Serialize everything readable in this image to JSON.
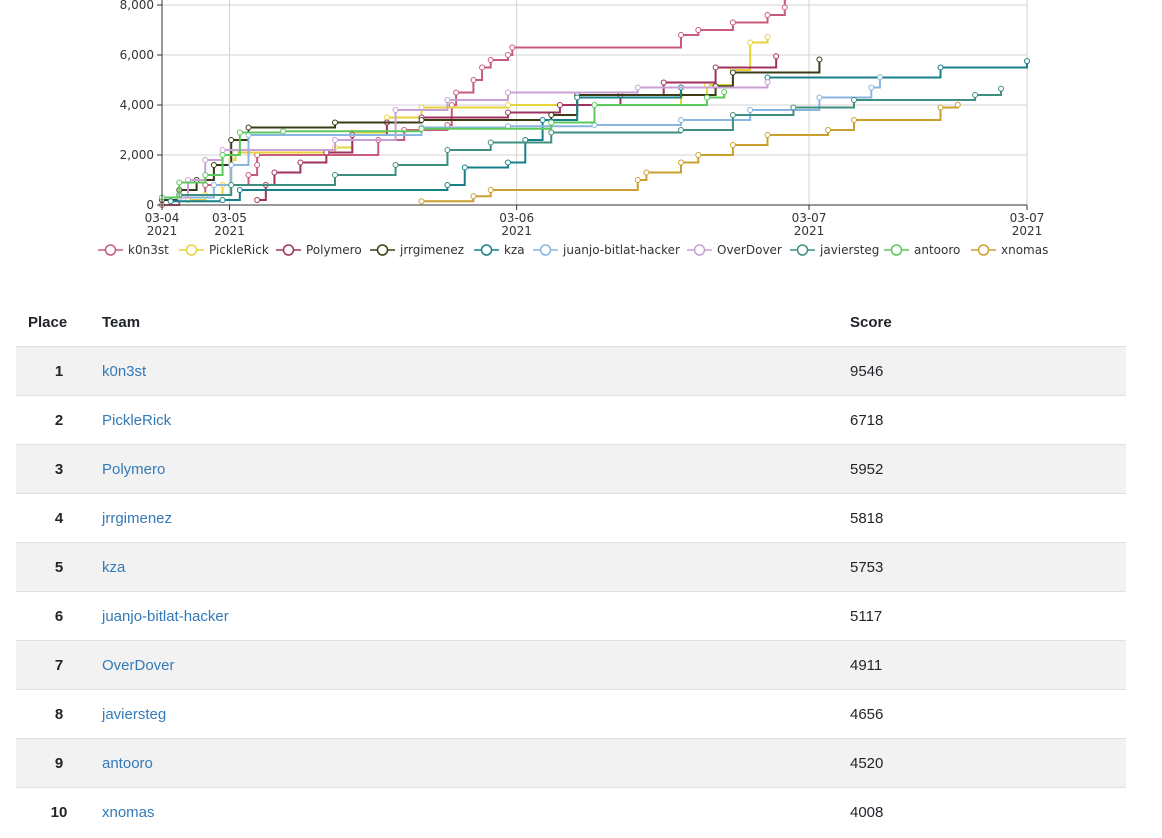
{
  "chart_data": {
    "type": "line",
    "yticks": [
      "0",
      "2,000",
      "4,000",
      "6,000",
      "8,000"
    ],
    "xticks": [
      {
        "t": "03-04",
        "line2": "2021",
        "x": 0
      },
      {
        "t": "03-05",
        "line2": "2021",
        "x": 0.078
      },
      {
        "t": "03-06",
        "line2": "2021",
        "x": 0.41
      },
      {
        "t": "03-07",
        "line2": "2021",
        "x": 0.748
      },
      {
        "t": "03-07",
        "line2": "2021",
        "x": 1.0
      }
    ],
    "ylim": [
      0,
      8400
    ],
    "xlim": [
      0,
      1
    ],
    "grid": true,
    "legend": "bottom",
    "series": [
      {
        "name": "k0n3st",
        "color": "#c75b7a",
        "points": [
          [
            0,
            0
          ],
          [
            0.02,
            400
          ],
          [
            0.05,
            800
          ],
          [
            0.1,
            1200
          ],
          [
            0.11,
            1600
          ],
          [
            0.11,
            2000
          ],
          [
            0.25,
            2600
          ],
          [
            0.28,
            3000
          ],
          [
            0.33,
            3200
          ],
          [
            0.335,
            4000
          ],
          [
            0.34,
            4500
          ],
          [
            0.36,
            5000
          ],
          [
            0.37,
            5500
          ],
          [
            0.38,
            5800
          ],
          [
            0.4,
            6000
          ],
          [
            0.405,
            6300
          ],
          [
            0.6,
            6800
          ],
          [
            0.62,
            7000
          ],
          [
            0.66,
            7300
          ],
          [
            0.7,
            7600
          ],
          [
            0.72,
            7900
          ],
          [
            0.72,
            8300
          ],
          [
            0.73,
            9546
          ]
        ]
      },
      {
        "name": "PickleRick",
        "color": "#e6d339",
        "points": [
          [
            0.03,
            200
          ],
          [
            0.05,
            400
          ],
          [
            0.07,
            800
          ],
          [
            0.08,
            1800
          ],
          [
            0.085,
            2100
          ],
          [
            0.2,
            2300
          ],
          [
            0.22,
            2900
          ],
          [
            0.26,
            3500
          ],
          [
            0.3,
            3900
          ],
          [
            0.4,
            4000
          ],
          [
            0.6,
            4400
          ],
          [
            0.63,
            4800
          ],
          [
            0.66,
            5400
          ],
          [
            0.68,
            6500
          ],
          [
            0.7,
            6718
          ]
        ]
      },
      {
        "name": "Polymero",
        "color": "#a0325f",
        "points": [
          [
            0.11,
            200
          ],
          [
            0.12,
            800
          ],
          [
            0.13,
            1300
          ],
          [
            0.16,
            1700
          ],
          [
            0.19,
            2100
          ],
          [
            0.22,
            2800
          ],
          [
            0.26,
            3300
          ],
          [
            0.3,
            3500
          ],
          [
            0.4,
            3700
          ],
          [
            0.46,
            4000
          ],
          [
            0.53,
            4400
          ],
          [
            0.58,
            4900
          ],
          [
            0.64,
            5500
          ],
          [
            0.71,
            5952
          ]
        ]
      },
      {
        "name": "jrrgimenez",
        "color": "#3b3b16",
        "points": [
          [
            0,
            200
          ],
          [
            0.02,
            600
          ],
          [
            0.04,
            1000
          ],
          [
            0.06,
            1600
          ],
          [
            0.08,
            2600
          ],
          [
            0.1,
            3100
          ],
          [
            0.2,
            3300
          ],
          [
            0.3,
            3400
          ],
          [
            0.45,
            3600
          ],
          [
            0.48,
            4400
          ],
          [
            0.64,
            4750
          ],
          [
            0.66,
            5300
          ],
          [
            0.76,
            5818
          ]
        ]
      },
      {
        "name": "kza",
        "color": "#17808a",
        "points": [
          [
            0.01,
            150
          ],
          [
            0.07,
            200
          ],
          [
            0.09,
            600
          ],
          [
            0.33,
            800
          ],
          [
            0.35,
            1500
          ],
          [
            0.4,
            1700
          ],
          [
            0.42,
            2600
          ],
          [
            0.44,
            3400
          ],
          [
            0.48,
            4300
          ],
          [
            0.6,
            4700
          ],
          [
            0.7,
            5100
          ],
          [
            0.9,
            5500
          ],
          [
            1.0,
            5753
          ]
        ]
      },
      {
        "name": "juanjo-bitlat-hacker",
        "color": "#88b6e0",
        "points": [
          [
            0.02,
            300
          ],
          [
            0.06,
            800
          ],
          [
            0.08,
            1600
          ],
          [
            0.1,
            2800
          ],
          [
            0.3,
            3100
          ],
          [
            0.4,
            3150
          ],
          [
            0.5,
            3200
          ],
          [
            0.6,
            3400
          ],
          [
            0.68,
            3800
          ],
          [
            0.76,
            4300
          ],
          [
            0.82,
            4700
          ],
          [
            0.83,
            5117
          ]
        ]
      },
      {
        "name": "OverDover",
        "color": "#c9a0d6",
        "points": [
          [
            0,
            300
          ],
          [
            0.03,
            1000
          ],
          [
            0.05,
            1800
          ],
          [
            0.07,
            2200
          ],
          [
            0.2,
            2600
          ],
          [
            0.27,
            3800
          ],
          [
            0.33,
            4200
          ],
          [
            0.4,
            4500
          ],
          [
            0.55,
            4700
          ],
          [
            0.7,
            4911
          ]
        ]
      },
      {
        "name": "javiersteg",
        "color": "#3f8f80",
        "points": [
          [
            0.02,
            400
          ],
          [
            0.08,
            800
          ],
          [
            0.2,
            1200
          ],
          [
            0.27,
            1600
          ],
          [
            0.33,
            2200
          ],
          [
            0.38,
            2500
          ],
          [
            0.45,
            2900
          ],
          [
            0.6,
            3000
          ],
          [
            0.66,
            3600
          ],
          [
            0.73,
            3900
          ],
          [
            0.8,
            4200
          ],
          [
            0.94,
            4400
          ],
          [
            0.97,
            4656
          ]
        ]
      },
      {
        "name": "antooro",
        "color": "#5cc95c",
        "points": [
          [
            0,
            300
          ],
          [
            0.02,
            900
          ],
          [
            0.05,
            1200
          ],
          [
            0.07,
            2000
          ],
          [
            0.09,
            2900
          ],
          [
            0.14,
            2950
          ],
          [
            0.3,
            3050
          ],
          [
            0.45,
            3300
          ],
          [
            0.5,
            4000
          ],
          [
            0.63,
            4300
          ],
          [
            0.65,
            4520
          ]
        ]
      },
      {
        "name": "xnomas",
        "color": "#c9a030",
        "points": [
          [
            0.3,
            150
          ],
          [
            0.36,
            350
          ],
          [
            0.38,
            600
          ],
          [
            0.55,
            1000
          ],
          [
            0.56,
            1300
          ],
          [
            0.6,
            1700
          ],
          [
            0.62,
            2000
          ],
          [
            0.66,
            2400
          ],
          [
            0.7,
            2800
          ],
          [
            0.77,
            3000
          ],
          [
            0.8,
            3400
          ],
          [
            0.9,
            3900
          ],
          [
            0.92,
            4008
          ]
        ]
      }
    ]
  },
  "table": {
    "headers": {
      "place": "Place",
      "team": "Team",
      "score": "Score"
    },
    "rows": [
      {
        "place": "1",
        "team": "k0n3st",
        "score": "9546"
      },
      {
        "place": "2",
        "team": "PickleRick",
        "score": "6718"
      },
      {
        "place": "3",
        "team": "Polymero",
        "score": "5952"
      },
      {
        "place": "4",
        "team": "jrrgimenez",
        "score": "5818"
      },
      {
        "place": "5",
        "team": "kza",
        "score": "5753"
      },
      {
        "place": "6",
        "team": "juanjo-bitlat-hacker",
        "score": "5117"
      },
      {
        "place": "7",
        "team": "OverDover",
        "score": "4911"
      },
      {
        "place": "8",
        "team": "javiersteg",
        "score": "4656"
      },
      {
        "place": "9",
        "team": "antooro",
        "score": "4520"
      },
      {
        "place": "10",
        "team": "xnomas",
        "score": "4008"
      }
    ]
  }
}
